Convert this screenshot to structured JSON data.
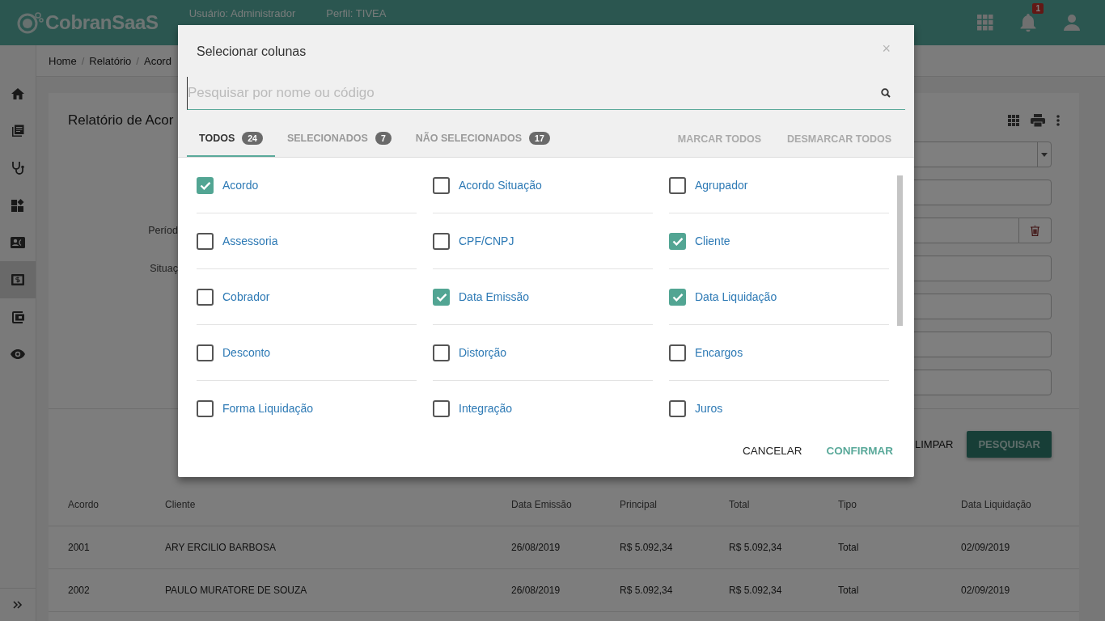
{
  "header": {
    "logo": "CobranSaaS",
    "user": "Usuário: Administrador",
    "profile": "Perfil: TIVEA",
    "notifications": "1"
  },
  "sidebar": {
    "items": [
      {
        "selected": false
      },
      {
        "selected": false
      },
      {
        "selected": false
      },
      {
        "selected": false
      },
      {
        "selected": false
      },
      {
        "selected": true
      },
      {
        "selected": false
      },
      {
        "selected": false
      }
    ]
  },
  "breadcrumb": [
    {
      "text": "Home",
      "kind": "link"
    },
    {
      "text": "/",
      "kind": "separator"
    },
    {
      "text": "Relatório",
      "kind": "link"
    },
    {
      "text": "/",
      "kind": "separator"
    },
    {
      "text": "Acord",
      "kind": "link"
    }
  ],
  "report": {
    "title": "Relatório de Acor",
    "form_labels": [
      "Períod",
      "Situaç"
    ],
    "buttons": [
      "LIMPAR",
      "PESQUISAR"
    ],
    "table": {
      "columns": [
        "Acordo",
        "Cliente",
        "Data Emissão",
        "Principal",
        "Total",
        "Tipo",
        "Data Liquidação"
      ],
      "rows": [
        [
          "2001",
          "ARY ERCILIO BARBOSA",
          "26/08/2019",
          "R$ 5.092,34",
          "R$ 5.092,34",
          "Total",
          "02/09/2019"
        ],
        [
          "2002",
          "PAULO MURATORE DE SOUZA",
          "26/08/2019",
          "R$ 5.092,34",
          "R$ 5.092,34",
          "Total",
          "02/09/2019"
        ]
      ]
    }
  },
  "dialog": {
    "title": "Selecionar colunas",
    "close": "×",
    "search": {
      "placeholder": "Pesquisar por nome ou código"
    },
    "tabs": [
      {
        "label": "TODOS",
        "count": "24",
        "selected": true
      },
      {
        "label": "SELECIONADOS",
        "count": "7",
        "selected": false
      },
      {
        "label": "NÃO SELECIONADOS",
        "count": "17",
        "selected": false
      }
    ],
    "actions": [
      "MARCAR TODOS",
      "DESMARCAR TODOS"
    ],
    "columns": [
      {
        "label": "Acordo",
        "checked": true
      },
      {
        "label": "Acordo Situação",
        "checked": false
      },
      {
        "label": "Agrupador",
        "checked": false
      },
      {
        "label": "Assessoria",
        "checked": false
      },
      {
        "label": "CPF/CNPJ",
        "checked": false
      },
      {
        "label": "Cliente",
        "checked": true
      },
      {
        "label": "Cobrador",
        "checked": false
      },
      {
        "label": "Data Emissão",
        "checked": true
      },
      {
        "label": "Data Liquidação",
        "checked": true
      },
      {
        "label": "Desconto",
        "checked": false
      },
      {
        "label": "Distorção",
        "checked": false
      },
      {
        "label": "Encargos",
        "checked": false
      },
      {
        "label": "Forma Liquidação",
        "checked": false
      },
      {
        "label": "Integração",
        "checked": false
      },
      {
        "label": "Juros",
        "checked": false
      }
    ],
    "buttons": [
      {
        "label": "CANCELAR",
        "kind": "plain"
      },
      {
        "label": "CONFIRMAR",
        "kind": "primary"
      }
    ]
  }
}
